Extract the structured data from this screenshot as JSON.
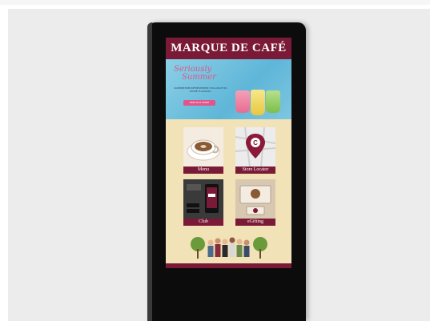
{
  "brand": {
    "name": "MARQUE DE CAFÉ"
  },
  "promo": {
    "title_line1": "Seriously",
    "title_line2": "Summer",
    "text": "SUMMERTIME REFRESHMENT. EXCLUSIVE IN-STORE FLAVOURS.",
    "button": "FIND OUT MORE"
  },
  "tiles": [
    {
      "label": "Menu"
    },
    {
      "label": "Store Locator"
    },
    {
      "label": "Club"
    },
    {
      "label": "eGifting"
    }
  ],
  "colors": {
    "brand": "#7a1a36",
    "panel": "#f2e2b8",
    "accent": "#e0568a"
  }
}
